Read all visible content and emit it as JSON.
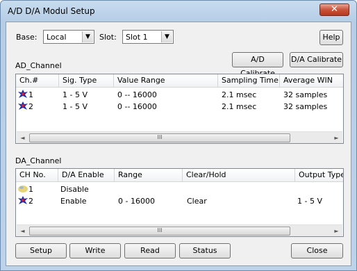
{
  "window": {
    "title": "A/D D/A Modul Setup",
    "close_glyph": "✕"
  },
  "base": {
    "label": "Base:",
    "value": "Local"
  },
  "slot": {
    "label": "Slot:",
    "value": "Slot 1"
  },
  "buttons": {
    "help": "Help",
    "ad_calibrate": "A/D Calibrate",
    "da_calibrate": "D/A Calibrate",
    "setup": "Setup",
    "write": "Write",
    "read": "Read",
    "status": "Status",
    "close": "Close"
  },
  "ad": {
    "title": "AD_Channel",
    "columns": [
      "Ch.#",
      "Sig. Type",
      "Value Range",
      "Sampling Time",
      "Average WIN"
    ],
    "rows": [
      {
        "ch": "1",
        "sig": "1 - 5 V",
        "range": "0 -- 16000",
        "time": "2.1 msec",
        "avg": "32 samples",
        "icon": "module-active-icon"
      },
      {
        "ch": "2",
        "sig": "1 - 5 V",
        "range": "0 -- 16000",
        "time": "2.1 msec",
        "avg": "32 samples",
        "icon": "module-active-icon"
      }
    ]
  },
  "da": {
    "title": "DA_Channel",
    "columns": [
      "CH No.",
      "D/A Enable",
      "Range",
      "Clear/Hold",
      "Output Type"
    ],
    "rows": [
      {
        "ch": "1",
        "enable": "Disable",
        "range": "",
        "clear": "",
        "output": "",
        "icon": "module-disabled-icon"
      },
      {
        "ch": "2",
        "enable": "Enable",
        "range": "0 - 16000",
        "clear": "Clear",
        "output": "1 - 5 V",
        "icon": "module-active-icon"
      }
    ]
  },
  "scrollbar": {
    "grip": "III",
    "left": "◄",
    "right": "►",
    "dropdown": "▼"
  },
  "colors": {
    "active_icon": "#1f2fa8",
    "active_icon_accent": "#d0202a",
    "disabled_icon": "#e6d47a"
  }
}
